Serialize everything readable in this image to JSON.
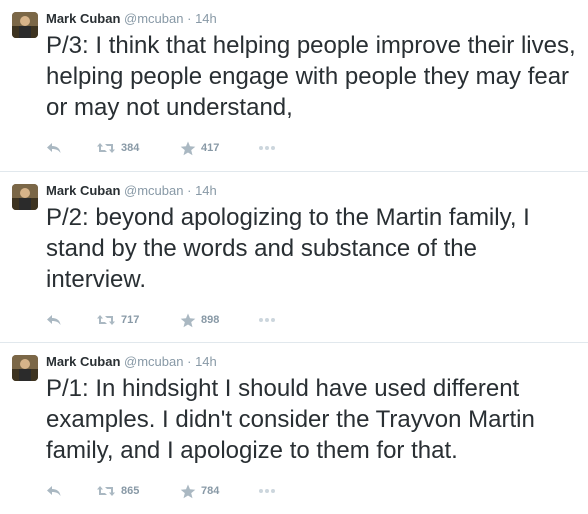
{
  "tweets": [
    {
      "name": "Mark Cuban",
      "handle": "@mcuban",
      "separator": "·",
      "time": "14h",
      "text": "P/3: I think that helping people improve their lives, helping people engage with people they may fear or may not understand,",
      "retweets": "384",
      "favorites": "417"
    },
    {
      "name": "Mark Cuban",
      "handle": "@mcuban",
      "separator": "·",
      "time": "14h",
      "text": "P/2: beyond apologizing to the Martin family,  I stand by the words and substance of the interview.",
      "retweets": "717",
      "favorites": "898"
    },
    {
      "name": "Mark Cuban",
      "handle": "@mcuban",
      "separator": "·",
      "time": "14h",
      "text": "P/1: In hindsight I should have used different examples.  I didn't consider the Trayvon Martin family, and I apologize to them for that.",
      "retweets": "865",
      "favorites": "784"
    }
  ],
  "icons": {
    "reply": "reply-icon",
    "retweet": "retweet-icon",
    "favorite": "star-icon",
    "more": "more-icon"
  },
  "colors": {
    "text": "#292f33",
    "muted": "#8899a6",
    "divider": "#e1e8ed"
  }
}
